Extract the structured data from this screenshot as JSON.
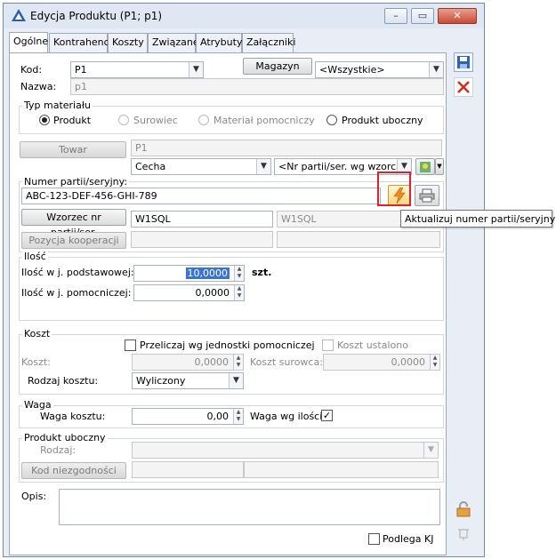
{
  "window": {
    "title": "Edycja Produktu (P1; p1)",
    "minimize": "–",
    "maximize": "▭",
    "close": "✕"
  },
  "tabs": [
    "Ogólne",
    "Kontrahenci",
    "Koszty",
    "Związane",
    "Atrybuty",
    "Załączniki"
  ],
  "header": {
    "kod_label": "Kod:",
    "kod_value": "P1",
    "nazwa_label": "Nazwa:",
    "nazwa_value": "p1",
    "magazyn_button": "Magazyn",
    "magazyn_value": "<Wszystkie>"
  },
  "typ_materialu": {
    "title": "Typ materiału",
    "options": [
      "Produkt",
      "Surowiec",
      "Materiał pomocniczy",
      "Produkt uboczny"
    ],
    "selected": "Produkt"
  },
  "towar": {
    "button": "Towar",
    "value": "P1",
    "cecha": "Cecha",
    "wzorzec": "<Nr partii/ser. wg wzorca>"
  },
  "partia": {
    "label": "Numer partii/seryjny:",
    "value": "ABC-123-DEF-456-GHI-789",
    "wzorzec_button": "Wzorzec nr partii/ser.",
    "wzorzec_value": "W1SQL",
    "wzorzec_value2": "W1SQL",
    "kooperacja_button": "Pozycja kooperacji",
    "tooltip": "Aktualizuj numer partii/seryjny"
  },
  "ilosc": {
    "title": "Ilość",
    "podstawowa_label": "Ilość w j. podstawowej:",
    "podstawowa_value": "10,0000",
    "unit": "szt.",
    "pomocnicza_label": "Ilość w j. pomocniczej:",
    "pomocnicza_value": "0,0000"
  },
  "koszt": {
    "title": "Koszt",
    "przeliczaj_label": "Przeliczaj wg jednostki pomocniczej",
    "ustalono_label": "Koszt ustalono",
    "koszt_label": "Koszt:",
    "koszt_value": "0,0000",
    "surowca_label": "Koszt surowca:",
    "surowca_value": "0,0000",
    "rodzaj_label": "Rodzaj kosztu:",
    "rodzaj_value": "Wyliczony"
  },
  "waga": {
    "title": "Waga",
    "kosztu_label": "Waga kosztu:",
    "kosztu_value": "0,00",
    "wg_ilosci_label": "Waga wg ilości:",
    "wg_ilosci_checked": "✓"
  },
  "produkt_uboczny": {
    "title": "Produkt uboczny",
    "rodzaj_label": "Rodzaj:",
    "kod_button": "Kod niezgodności"
  },
  "opis": {
    "label": "Opis:",
    "podlega_kj": "Podlega KJ"
  },
  "colors": {
    "accent": "#3a73d6",
    "highlight_border": "#e0202a",
    "window_border": "#6f89b0"
  }
}
